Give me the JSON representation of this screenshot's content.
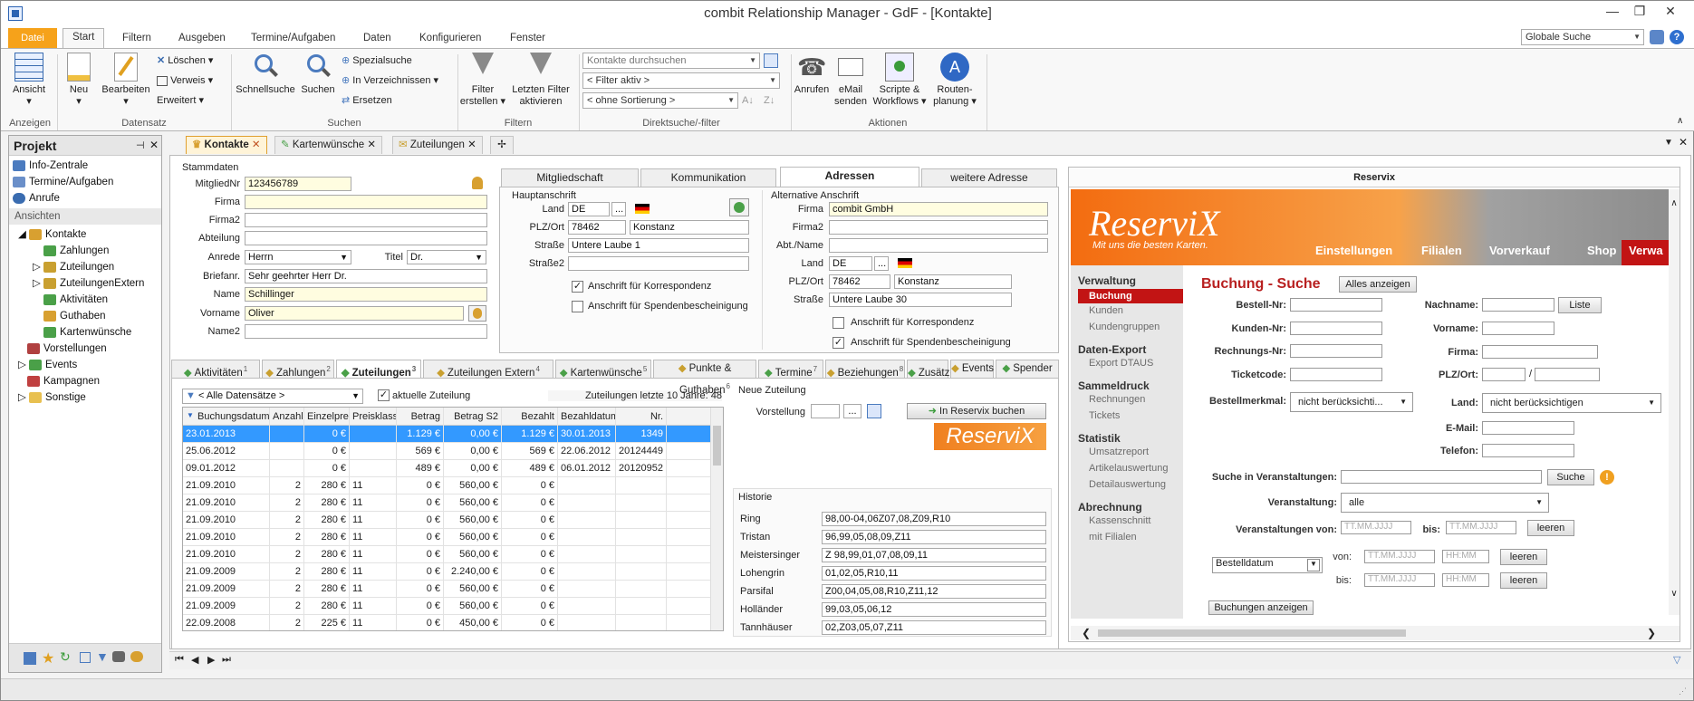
{
  "window": {
    "title": "combit Relationship Manager - GdF - [Kontakte]"
  },
  "menu": {
    "tabs": [
      "Datei",
      "Start",
      "Filtern",
      "Ausgeben",
      "Termine/Aufgaben",
      "Daten",
      "Konfigurieren",
      "Fenster"
    ],
    "global_search": "Globale Suche"
  },
  "ribbon": {
    "ansicht": "Ansicht",
    "neu": "Neu",
    "bearbeiten": "Bearbeiten",
    "loeschen": "Löschen",
    "verweis": "Verweis",
    "erweitert": "Erweitert",
    "schnellsuche": "Schnellsuche",
    "suchen": "Suchen",
    "spezialsuche": "Spezialsuche",
    "in_verzeichnissen": "In Verzeichnissen",
    "ersetzen": "Ersetzen",
    "filter_erstellen_1": "Filter",
    "filter_erstellen_2": "erstellen",
    "letzten_filter_1": "Letzten Filter",
    "letzten_filter_2": "aktivieren",
    "direktsuche_placeholder": "Kontakte durchsuchen",
    "filter_aktiv": "< Filter aktiv >",
    "sortierung": "< ohne Sortierung >",
    "anrufen": "Anrufen",
    "email_1": "eMail",
    "email_2": "senden",
    "scripte_1": "Scripte &",
    "scripte_2": "Workflows",
    "routen_1": "Routen-",
    "routen_2": "planung",
    "groups": {
      "anzeigen": "Anzeigen",
      "datensatz": "Datensatz",
      "suchen": "Suchen",
      "filtern": "Filtern",
      "direktsuche": "Direktsuche/-filter",
      "aktionen": "Aktionen"
    }
  },
  "project": {
    "title": "Projekt",
    "items": [
      "Info-Zentrale",
      "Termine/Aufgaben",
      "Anrufe"
    ],
    "section": "Ansichten",
    "tree": [
      "Kontakte",
      "Zahlungen",
      "Zuteilungen",
      "ZuteilungenExtern",
      "Aktivitäten",
      "Guthaben",
      "Kartenwünsche",
      "Vorstellungen",
      "Events",
      "Kampagnen",
      "Sonstige"
    ]
  },
  "doctabs": [
    "Kontakte",
    "Kartenwünsche",
    "Zuteilungen"
  ],
  "stammdaten": {
    "title": "Stammdaten",
    "mitgliednr_label": "MitgliedNr",
    "mitgliednr": "123456789",
    "firma_label": "Firma",
    "firma2_label": "Firma2",
    "abteilung_label": "Abteilung",
    "anrede_label": "Anrede",
    "anrede": "Herrn",
    "titel_label": "Titel",
    "titel": "Dr.",
    "briefanr_label": "Briefanr.",
    "briefanr": "Sehr geehrter Herr Dr.",
    "name_label": "Name",
    "name": "Schillinger",
    "vorname_label": "Vorname",
    "vorname": "Oliver",
    "name2_label": "Name2"
  },
  "addr_tabs": [
    "Mitgliedschaft",
    "Kommunikation",
    "Adressen",
    "weitere Adresse"
  ],
  "haupt": {
    "title": "Hauptanschrift",
    "land_label": "Land",
    "land": "DE",
    "plz_label": "PLZ/Ort",
    "plz": "78462",
    "ort": "Konstanz",
    "strasse_label": "Straße",
    "strasse": "Untere Laube 1",
    "strasse2_label": "Straße2",
    "chk1": "Anschrift für Korrespondenz",
    "chk2": "Anschrift für Spendenbescheinigung"
  },
  "alt": {
    "title": "Alternative Anschrift",
    "firma_label": "Firma",
    "firma": "combit GmbH",
    "firma2_label": "Firma2",
    "abt_label": "Abt./Name",
    "land_label": "Land",
    "land": "DE",
    "plz_label": "PLZ/Ort",
    "plz": "78462",
    "ort": "Konstanz",
    "strasse_label": "Straße",
    "strasse": "Untere Laube 30",
    "chk1": "Anschrift für Korrespondenz",
    "chk2": "Anschrift für Spendenbescheinigung"
  },
  "subtabs": [
    "Aktivitäten",
    "Zahlungen",
    "Zuteilungen",
    "Zuteilungen Extern",
    "Kartenwünsche",
    "Punkte & Guthaben",
    "Termine",
    "Beziehungen",
    "Zusätze",
    "Events",
    "Spender"
  ],
  "subtab_nums": [
    "1",
    "2",
    "3",
    "4",
    "5",
    "6",
    "7",
    "8",
    "9"
  ],
  "zut": {
    "filter": "< Alle Datensätze >",
    "aktuelle": "aktuelle Zuteilung",
    "letzte": "Zuteilungen letzte 10 Jahre: 48",
    "columns": [
      "Buchungsdatum",
      "Anzahl",
      "Einzelpreis",
      "Preisklasse",
      "Betrag",
      "Betrag S2",
      "Bezahlt",
      "Bezahldatum",
      "Nr."
    ],
    "rows": [
      [
        "23.01.2013",
        "",
        "0 €",
        "",
        "1.129 €",
        "0,00 €",
        "1.129 €",
        "30.01.2013",
        "1349"
      ],
      [
        "25.06.2012",
        "",
        "0 €",
        "",
        "569 €",
        "0,00 €",
        "569 €",
        "22.06.2012",
        "20124449"
      ],
      [
        "09.01.2012",
        "",
        "0 €",
        "",
        "489 €",
        "0,00 €",
        "489 €",
        "06.01.2012",
        "20120952"
      ],
      [
        "21.09.2010",
        "2",
        "280 €",
        "11",
        "0 €",
        "560,00 €",
        "0 €",
        "",
        ""
      ],
      [
        "21.09.2010",
        "2",
        "280 €",
        "11",
        "0 €",
        "560,00 €",
        "0 €",
        "",
        ""
      ],
      [
        "21.09.2010",
        "2",
        "280 €",
        "11",
        "0 €",
        "560,00 €",
        "0 €",
        "",
        ""
      ],
      [
        "21.09.2010",
        "2",
        "280 €",
        "11",
        "0 €",
        "560,00 €",
        "0 €",
        "",
        ""
      ],
      [
        "21.09.2010",
        "2",
        "280 €",
        "11",
        "0 €",
        "560,00 €",
        "0 €",
        "",
        ""
      ],
      [
        "21.09.2009",
        "2",
        "280 €",
        "11",
        "0 €",
        "2.240,00 €",
        "0 €",
        "",
        ""
      ],
      [
        "21.09.2009",
        "2",
        "280 €",
        "11",
        "0 €",
        "560,00 €",
        "0 €",
        "",
        ""
      ],
      [
        "21.09.2009",
        "2",
        "280 €",
        "11",
        "0 €",
        "560,00 €",
        "0 €",
        "",
        ""
      ],
      [
        "22.09.2008",
        "2",
        "225 €",
        "11",
        "0 €",
        "450,00 €",
        "0 €",
        "",
        ""
      ]
    ]
  },
  "neue": {
    "title": "Neue Zuteilung",
    "vorstellung_label": "Vorstellung",
    "button": "In Reservix buchen",
    "logo": "ReserviX"
  },
  "historie": {
    "title": "Historie",
    "rows": [
      [
        "Ring",
        "98,00-04,06Z07,08,Z09,R10"
      ],
      [
        "Tristan",
        "96,99,05,08,09,Z11"
      ],
      [
        "Meistersinger",
        "Z 98,99,01,07,08,09,11"
      ],
      [
        "Lohengrin",
        "01,02,05,R10,11"
      ],
      [
        "Parsifal",
        "Z00,04,05,08,R10,Z11,12"
      ],
      [
        "Holländer",
        "99,03,05,06,12"
      ],
      [
        "Tannhäuser",
        "02,Z03,05,07,Z11"
      ]
    ]
  },
  "reservix": {
    "panel_title": "Reservix",
    "logo": "ReserviX",
    "tagline": "Mit uns die besten Karten.",
    "nav": [
      "Einstellungen",
      "Filialen",
      "Vorverkauf",
      "Shop",
      "Verwa"
    ],
    "side": [
      {
        "h": "Verwaltung",
        "items": [
          "Buchung",
          "Kunden",
          "Kundengruppen"
        ]
      },
      {
        "h": "Daten-Export",
        "items": [
          "Export DTAUS"
        ]
      },
      {
        "h": "Sammeldruck",
        "items": [
          "Rechnungen",
          "Tickets"
        ]
      },
      {
        "h": "Statistik",
        "items": [
          "Umsatzreport",
          "Artikelauswertung",
          "Detailauswertung"
        ]
      },
      {
        "h": "Abrechnung",
        "items": [
          "Kassenschnitt",
          "mit Filialen"
        ]
      }
    ],
    "heading": "Buchung - Suche",
    "alles": "Alles anzeigen",
    "bestellnr": "Bestell-Nr:",
    "kundennr": "Kunden-Nr:",
    "rechnungsnr": "Rechnungs-Nr:",
    "ticketcode": "Ticketcode:",
    "bestellmerkmal": "Bestellmerkmal:",
    "nicht": "nicht berücksichti...",
    "nachname": "Nachname:",
    "liste": "Liste",
    "vorname": "Vorname:",
    "firma": "Firma:",
    "plzort": "PLZ/Ort:",
    "land": "Land:",
    "land_val": "nicht berücksichtigen",
    "email": "E-Mail:",
    "telefon": "Telefon:",
    "suche_in": "Suche in Veranstaltungen:",
    "suche_btn": "Suche",
    "veranstaltung": "Veranstaltung:",
    "alle": "alle",
    "von_label": "Veranstaltungen von:",
    "bis_label": "bis:",
    "date_ph": "TT.MM.JJJJ",
    "time_ph": "HH:MM",
    "leeren": "leeren",
    "bestelldatum": "Bestelldatum",
    "von": "von:",
    "bis": "bis:",
    "anzeigen": "Buchungen anzeigen"
  }
}
